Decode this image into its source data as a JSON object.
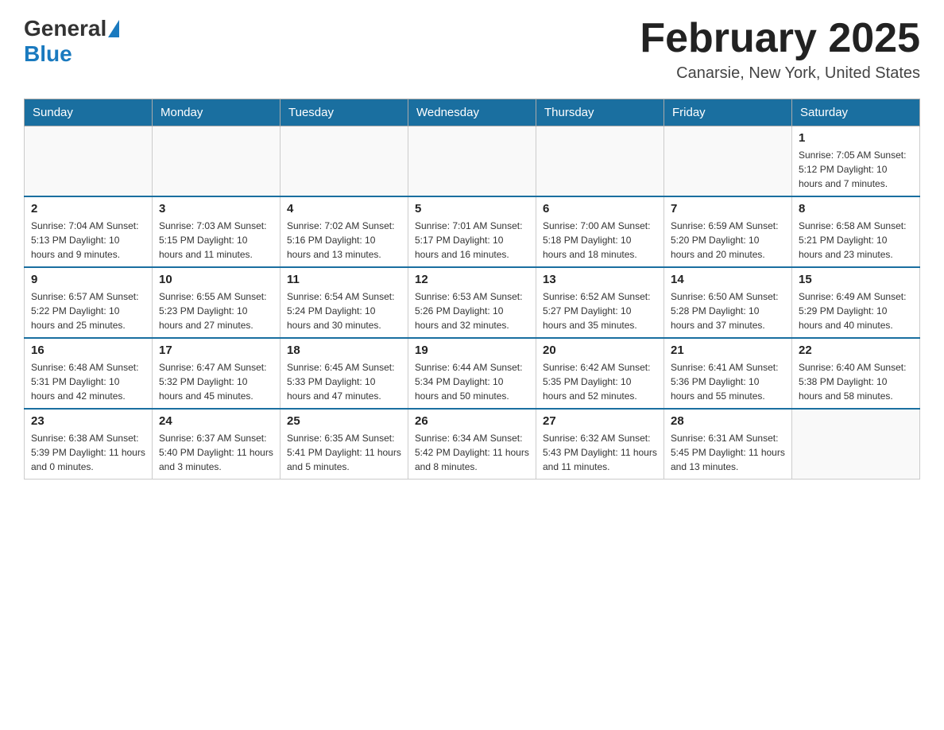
{
  "header": {
    "logo_general": "General",
    "logo_blue": "Blue",
    "month_title": "February 2025",
    "location": "Canarsie, New York, United States"
  },
  "days_of_week": [
    "Sunday",
    "Monday",
    "Tuesday",
    "Wednesday",
    "Thursday",
    "Friday",
    "Saturday"
  ],
  "weeks": [
    [
      {
        "day": "",
        "info": ""
      },
      {
        "day": "",
        "info": ""
      },
      {
        "day": "",
        "info": ""
      },
      {
        "day": "",
        "info": ""
      },
      {
        "day": "",
        "info": ""
      },
      {
        "day": "",
        "info": ""
      },
      {
        "day": "1",
        "info": "Sunrise: 7:05 AM\nSunset: 5:12 PM\nDaylight: 10 hours and 7 minutes."
      }
    ],
    [
      {
        "day": "2",
        "info": "Sunrise: 7:04 AM\nSunset: 5:13 PM\nDaylight: 10 hours and 9 minutes."
      },
      {
        "day": "3",
        "info": "Sunrise: 7:03 AM\nSunset: 5:15 PM\nDaylight: 10 hours and 11 minutes."
      },
      {
        "day": "4",
        "info": "Sunrise: 7:02 AM\nSunset: 5:16 PM\nDaylight: 10 hours and 13 minutes."
      },
      {
        "day": "5",
        "info": "Sunrise: 7:01 AM\nSunset: 5:17 PM\nDaylight: 10 hours and 16 minutes."
      },
      {
        "day": "6",
        "info": "Sunrise: 7:00 AM\nSunset: 5:18 PM\nDaylight: 10 hours and 18 minutes."
      },
      {
        "day": "7",
        "info": "Sunrise: 6:59 AM\nSunset: 5:20 PM\nDaylight: 10 hours and 20 minutes."
      },
      {
        "day": "8",
        "info": "Sunrise: 6:58 AM\nSunset: 5:21 PM\nDaylight: 10 hours and 23 minutes."
      }
    ],
    [
      {
        "day": "9",
        "info": "Sunrise: 6:57 AM\nSunset: 5:22 PM\nDaylight: 10 hours and 25 minutes."
      },
      {
        "day": "10",
        "info": "Sunrise: 6:55 AM\nSunset: 5:23 PM\nDaylight: 10 hours and 27 minutes."
      },
      {
        "day": "11",
        "info": "Sunrise: 6:54 AM\nSunset: 5:24 PM\nDaylight: 10 hours and 30 minutes."
      },
      {
        "day": "12",
        "info": "Sunrise: 6:53 AM\nSunset: 5:26 PM\nDaylight: 10 hours and 32 minutes."
      },
      {
        "day": "13",
        "info": "Sunrise: 6:52 AM\nSunset: 5:27 PM\nDaylight: 10 hours and 35 minutes."
      },
      {
        "day": "14",
        "info": "Sunrise: 6:50 AM\nSunset: 5:28 PM\nDaylight: 10 hours and 37 minutes."
      },
      {
        "day": "15",
        "info": "Sunrise: 6:49 AM\nSunset: 5:29 PM\nDaylight: 10 hours and 40 minutes."
      }
    ],
    [
      {
        "day": "16",
        "info": "Sunrise: 6:48 AM\nSunset: 5:31 PM\nDaylight: 10 hours and 42 minutes."
      },
      {
        "day": "17",
        "info": "Sunrise: 6:47 AM\nSunset: 5:32 PM\nDaylight: 10 hours and 45 minutes."
      },
      {
        "day": "18",
        "info": "Sunrise: 6:45 AM\nSunset: 5:33 PM\nDaylight: 10 hours and 47 minutes."
      },
      {
        "day": "19",
        "info": "Sunrise: 6:44 AM\nSunset: 5:34 PM\nDaylight: 10 hours and 50 minutes."
      },
      {
        "day": "20",
        "info": "Sunrise: 6:42 AM\nSunset: 5:35 PM\nDaylight: 10 hours and 52 minutes."
      },
      {
        "day": "21",
        "info": "Sunrise: 6:41 AM\nSunset: 5:36 PM\nDaylight: 10 hours and 55 minutes."
      },
      {
        "day": "22",
        "info": "Sunrise: 6:40 AM\nSunset: 5:38 PM\nDaylight: 10 hours and 58 minutes."
      }
    ],
    [
      {
        "day": "23",
        "info": "Sunrise: 6:38 AM\nSunset: 5:39 PM\nDaylight: 11 hours and 0 minutes."
      },
      {
        "day": "24",
        "info": "Sunrise: 6:37 AM\nSunset: 5:40 PM\nDaylight: 11 hours and 3 minutes."
      },
      {
        "day": "25",
        "info": "Sunrise: 6:35 AM\nSunset: 5:41 PM\nDaylight: 11 hours and 5 minutes."
      },
      {
        "day": "26",
        "info": "Sunrise: 6:34 AM\nSunset: 5:42 PM\nDaylight: 11 hours and 8 minutes."
      },
      {
        "day": "27",
        "info": "Sunrise: 6:32 AM\nSunset: 5:43 PM\nDaylight: 11 hours and 11 minutes."
      },
      {
        "day": "28",
        "info": "Sunrise: 6:31 AM\nSunset: 5:45 PM\nDaylight: 11 hours and 13 minutes."
      },
      {
        "day": "",
        "info": ""
      }
    ]
  ]
}
